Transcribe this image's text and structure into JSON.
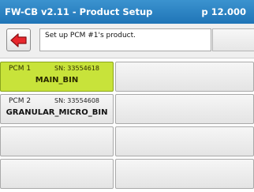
{
  "header": {
    "title": "FW-CB v2.11 - Product Setup",
    "price": "p 12.000"
  },
  "toolbar": {
    "back_icon": "left-arrow-icon",
    "message": "Set up PCM #1's product."
  },
  "pcms": [
    {
      "label": "PCM 1",
      "sn": "SN: 33554618",
      "product": "MAIN_BIN",
      "selected": true
    },
    {
      "label": "PCM 2",
      "sn": "SN: 33554608",
      "product": "GRANULAR_MICRO_BIN",
      "selected": false
    }
  ],
  "colors": {
    "titlebar": "#2583c4",
    "selected": "#c8e33a",
    "arrow": "#e8262c"
  }
}
